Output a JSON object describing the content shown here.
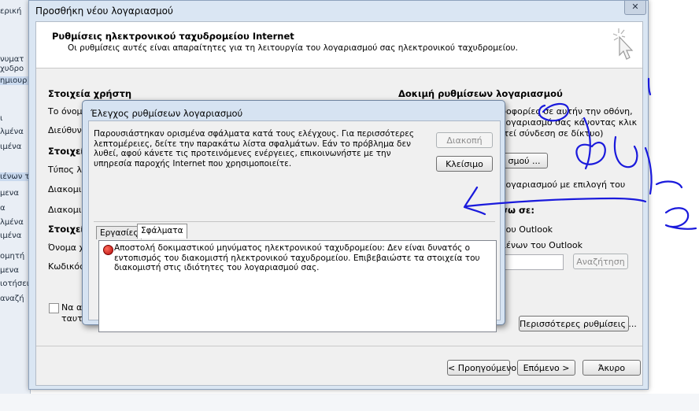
{
  "background": {
    "left_items": [
      "ερική",
      "",
      "νυματ",
      "χυδρο",
      "ημιουρ",
      "",
      "ι",
      "λμένα",
      "ιμένα",
      "",
      "ιένων τ",
      "μενα",
      "α",
      "λμένα",
      "ιμένα",
      "ομητή",
      "μενα",
      "ιοτήσει",
      "αναζή"
    ]
  },
  "wizard": {
    "title": "Προσθήκη νέου λογαριασμού",
    "close_glyph": "✕",
    "header": {
      "title": "Ρυθμίσεις ηλεκτρονικού ταχυδρομείου Internet",
      "subtitle": "Οι ρυθμίσεις αυτές είναι απαραίτητες για τη λειτουργία του λογαριασμού σας ηλεκτρονικού ταχυδρομείου."
    },
    "left": {
      "user_section": "Στοιχεία χρήστη",
      "name_label": "Το όνομ",
      "email_label": "Διεύθυνσ",
      "server_section": "Στοιχεία",
      "account_type_label": "Τύπος λο",
      "incoming_label": "Διακομισ",
      "outgoing_label": "Διακομιστ",
      "logon_section": "Στοιχεία",
      "username_label": "Όνομα χρ",
      "password_label": "Κωδικός",
      "spa_label_1": "Να απ",
      "spa_label_2": "ταυτό"
    },
    "right": {
      "test_section": "Δοκιμή ρυθμίσεων λογαριασμού",
      "test_text_1": "ροφορίες σε αυτήν την οθόνη,",
      "test_text_2": "λογαριασμό σας κάνοντας κλικ",
      "test_text_3": "ιτεί σύνδεση σε δίκτυο)",
      "test_button": "σμού ...",
      "test_next_label": "λογαριασμού με επιλογή του",
      "deliver_label": "σω σε:",
      "opt_new_file": "του Outlook",
      "opt_existing_file": "μένων του Outlook",
      "browse_button": "Αναζήτηση",
      "more_settings_button": "Περισσότερες ρυθμίσεις ..."
    },
    "footer": {
      "back_button": "< Προηγούμενο",
      "next_button": "Επόμενο >",
      "cancel_button": "Άκυρο"
    }
  },
  "error_dialog": {
    "title": "Έλεγχος ρυθμίσεων λογαριασμού",
    "message": "Παρουσιάστηκαν ορισμένα σφάλματα κατά τους ελέγχους. Για περισσότερες λεπτομέρειες, δείτε την παρακάτω λίστα σφαλμάτων. Εάν το πρόβλημα δεν λυθεί, αφού κάνετε τις προτεινόμενες ενέργειες, επικοινωνήστε με την υπηρεσία παροχής Internet που χρησιμοποιείτε.",
    "stop_button": "Διακοπή",
    "close_button": "Κλείσιμο",
    "tabs": [
      "Εργασίες",
      "Σφάλματα"
    ],
    "active_tab": 1,
    "errors": [
      "Αποστολή δοκιμαστικού μηνύματος ηλεκτρονικού ταχυδρομείου: Δεν είναι δυνατός ο εντοπισμός του διακομιστή ηλεκτρονικού ταχυδρομείου. Επιβεβαιώστε τα στοιχεία του διακομιστή στις ιδιότητες του λογαριασμού σας."
    ]
  },
  "annotation": {
    "ink_color": "#1a1adc",
    "handwriting": "φα"
  }
}
